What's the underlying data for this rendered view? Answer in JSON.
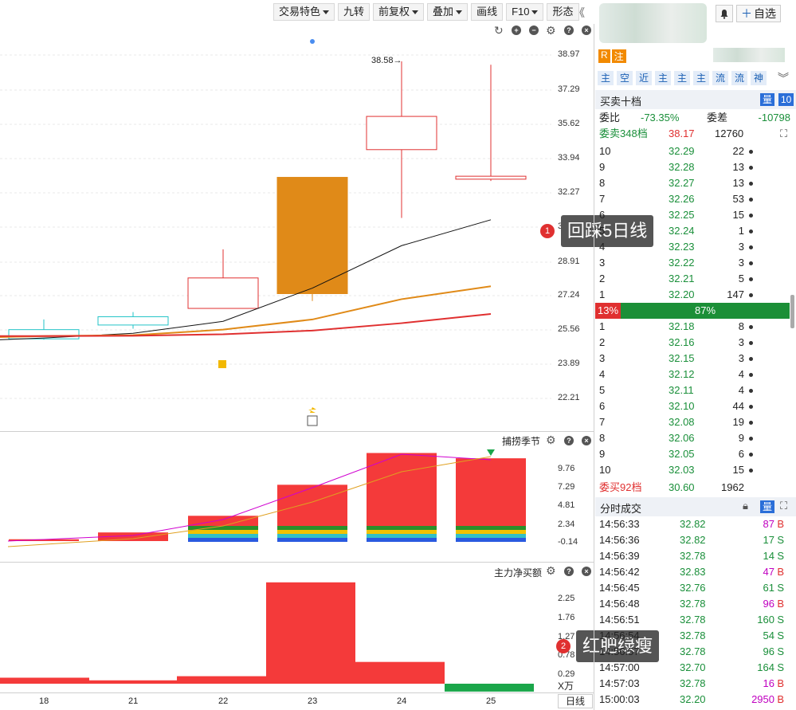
{
  "toolbar": {
    "items": [
      "交易特色",
      "九转",
      "前复权",
      "叠加",
      "画线",
      "F10",
      "形态"
    ],
    "collapse_icon": "double-chevron-left-icon",
    "add_watch_label": "自选",
    "bell_icon": "bell-icon"
  },
  "price_axis": [
    "38.97",
    "37.29",
    "35.62",
    "33.94",
    "32.27",
    "30.",
    "28.91",
    "27.24",
    "25.56",
    "23.89",
    "22.21"
  ],
  "high_label": "38.58",
  "indicator1": {
    "title": "捕捞季节",
    "axis": [
      "9.76",
      "7.29",
      "4.81",
      "2.34",
      "-0.14"
    ]
  },
  "indicator2": {
    "title": "主力净买额",
    "axis": [
      "2.25",
      "1.76",
      "1.27",
      "0.78",
      "0.29"
    ],
    "unit": "X万"
  },
  "dates": [
    "18",
    "21",
    "22",
    "23",
    "24",
    "25"
  ],
  "period_label": "日线",
  "candles": [
    {
      "date": "18",
      "open": 23.55,
      "close": 24.05,
      "high": 24.6,
      "low": 23.5,
      "color": "#22c3c7"
    },
    {
      "date": "21",
      "open": 24.3,
      "close": 24.75,
      "high": 25.0,
      "low": 24.1,
      "color": "#22c3c7"
    },
    {
      "date": "22",
      "open": 25.2,
      "close": 26.85,
      "high": 28.4,
      "low": 25.2,
      "color": "#e03030"
    },
    {
      "date": "23",
      "open": 32.3,
      "close": 26.0,
      "high": 32.3,
      "low": 25.6,
      "color": "#e08a18",
      "filled": true
    },
    {
      "date": "24",
      "open": 33.8,
      "close": 35.6,
      "high": 38.58,
      "low": 30.1,
      "color": "#e03030"
    },
    {
      "date": "25",
      "open": 32.2,
      "close": 32.36,
      "high": 38.4,
      "low": 32.1,
      "color": "#e03030"
    }
  ],
  "ma_lines": [
    {
      "name": "ma5",
      "color": "#111111",
      "values": [
        23.5,
        23.6,
        23.85,
        24.5,
        26.3,
        28.6,
        30.0
      ]
    },
    {
      "name": "ma10",
      "color": "#e08a18",
      "values": [
        23.65,
        23.7,
        23.75,
        24.05,
        24.6,
        25.7,
        26.4
      ]
    },
    {
      "name": "ma20",
      "color": "#e03030",
      "values": [
        23.7,
        23.7,
        23.72,
        23.8,
        24.0,
        24.4,
        24.9
      ]
    }
  ],
  "ind1_bars": [
    0.1,
    1.0,
    3.2,
    7.3,
    11.5,
    10.8
  ],
  "ind2_bars": [
    0.16,
    0.09,
    0.2,
    2.7,
    0.58,
    -0.21
  ],
  "right_tabs": {
    "r": "R",
    "zhu": "注",
    "chips": [
      "主",
      "空",
      "近",
      "主",
      "主",
      "主",
      "流",
      "流",
      "神"
    ]
  },
  "order_book": {
    "title": "买卖十档",
    "level_btn": "量",
    "level_num": "10",
    "wei_bi_label": "委比",
    "wei_bi": "-73.35%",
    "wei_cha_label": "委差",
    "wei_cha": "-10798",
    "sell_total_label": "委卖348档",
    "sell_total_price": "38.17",
    "sell_total_vol": "12760",
    "sells": [
      [
        "10",
        "32.29",
        "22"
      ],
      [
        "9",
        "32.28",
        "13"
      ],
      [
        "8",
        "32.27",
        "13"
      ],
      [
        "7",
        "32.26",
        "53"
      ],
      [
        "6",
        "32.25",
        "15"
      ],
      [
        "5",
        "32.24",
        "1"
      ],
      [
        "4",
        "32.23",
        "3"
      ],
      [
        "3",
        "32.22",
        "3"
      ],
      [
        "2",
        "32.21",
        "5"
      ],
      [
        "1",
        "32.20",
        "147"
      ]
    ],
    "ratio_red": "13%",
    "ratio_green": "87%",
    "ratio_red_frac": 0.13,
    "buys": [
      [
        "1",
        "32.18",
        "8"
      ],
      [
        "2",
        "32.16",
        "3"
      ],
      [
        "3",
        "32.15",
        "3"
      ],
      [
        "4",
        "32.12",
        "4"
      ],
      [
        "5",
        "32.11",
        "4"
      ],
      [
        "6",
        "32.10",
        "44"
      ],
      [
        "7",
        "32.08",
        "19"
      ],
      [
        "8",
        "32.06",
        "9"
      ],
      [
        "9",
        "32.05",
        "6"
      ],
      [
        "10",
        "32.03",
        "15"
      ]
    ],
    "buy_total_label": "委买92档",
    "buy_total_price": "30.60",
    "buy_total_vol": "1962"
  },
  "ticks": {
    "title": "分时成交",
    "rows": [
      [
        "14:56:33",
        "32.82",
        "87",
        "B"
      ],
      [
        "14:56:36",
        "32.82",
        "17",
        "S"
      ],
      [
        "14:56:39",
        "32.78",
        "14",
        "S"
      ],
      [
        "14:56:42",
        "32.83",
        "47",
        "B"
      ],
      [
        "14:56:45",
        "32.76",
        "61",
        "S"
      ],
      [
        "14:56:48",
        "32.78",
        "96",
        "B"
      ],
      [
        "14:56:51",
        "32.78",
        "160",
        "S"
      ],
      [
        "14:56:54",
        "32.78",
        "54",
        "S"
      ],
      [
        "14:56:57",
        "32.78",
        "96",
        "S"
      ],
      [
        "14:57:00",
        "32.70",
        "164",
        "S"
      ],
      [
        "14:57:03",
        "32.78",
        "16",
        "B"
      ],
      [
        "15:00:03",
        "32.20",
        "2950",
        "B"
      ]
    ]
  },
  "callouts": [
    {
      "num": "1",
      "text": "回踩5日线"
    },
    {
      "num": "2",
      "text": "红肥绿瘦"
    }
  ]
}
